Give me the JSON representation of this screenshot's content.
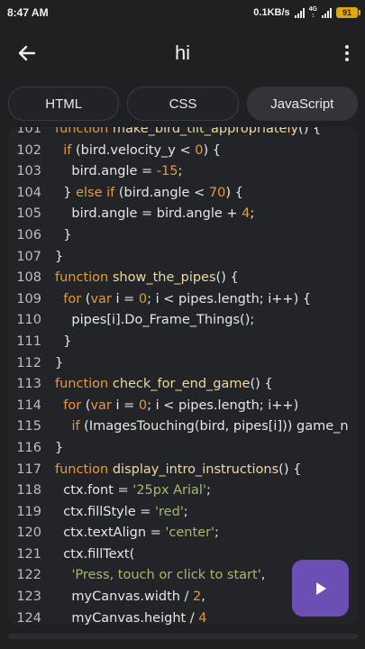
{
  "status": {
    "time": "8:47 AM",
    "netspeed": "0.1KB/s",
    "network": "4G",
    "battery": "91"
  },
  "appbar": {
    "title": "hi"
  },
  "tabs": [
    "HTML",
    "CSS",
    "JavaScript"
  ],
  "active_tab": "JavaScript",
  "code_lines": [
    {
      "n": "101",
      "tokens": [
        [
          "kw",
          "function "
        ],
        [
          "fn",
          "make_bird_tilt_appropriately"
        ],
        [
          "",
          "() {"
        ]
      ]
    },
    {
      "n": "102",
      "tokens": [
        [
          "",
          "  "
        ],
        [
          "kw",
          "if"
        ],
        [
          "",
          " (bird.velocity_y < "
        ],
        [
          "num",
          "0"
        ],
        [
          "",
          ") {"
        ]
      ]
    },
    {
      "n": "103",
      "tokens": [
        [
          "",
          "    bird.angle = "
        ],
        [
          "num",
          "-15"
        ],
        [
          "",
          ";"
        ]
      ]
    },
    {
      "n": "104",
      "tokens": [
        [
          "",
          "  } "
        ],
        [
          "kw",
          "else if"
        ],
        [
          "",
          " (bird.angle < "
        ],
        [
          "num",
          "70"
        ],
        [
          "",
          ") {"
        ]
      ]
    },
    {
      "n": "105",
      "tokens": [
        [
          "",
          "    bird.angle = bird.angle + "
        ],
        [
          "num",
          "4"
        ],
        [
          "",
          ";"
        ]
      ]
    },
    {
      "n": "106",
      "tokens": [
        [
          "",
          "  }"
        ]
      ]
    },
    {
      "n": "107",
      "tokens": [
        [
          "",
          "}"
        ]
      ]
    },
    {
      "n": "108",
      "tokens": [
        [
          "kw",
          "function "
        ],
        [
          "fn",
          "show_the_pipes"
        ],
        [
          "",
          "() {"
        ]
      ]
    },
    {
      "n": "109",
      "tokens": [
        [
          "",
          "  "
        ],
        [
          "kw",
          "for"
        ],
        [
          "",
          " ("
        ],
        [
          "kw",
          "var"
        ],
        [
          "",
          " i = "
        ],
        [
          "num",
          "0"
        ],
        [
          "",
          "; i < pipes.length; i++) {"
        ]
      ]
    },
    {
      "n": "110",
      "tokens": [
        [
          "",
          "    pipes[i].Do_Frame_Things();"
        ]
      ]
    },
    {
      "n": "111",
      "tokens": [
        [
          "",
          "  }"
        ]
      ]
    },
    {
      "n": "112",
      "tokens": [
        [
          "",
          "}"
        ]
      ]
    },
    {
      "n": "113",
      "tokens": [
        [
          "kw",
          "function "
        ],
        [
          "fn",
          "check_for_end_game"
        ],
        [
          "",
          "() {"
        ]
      ]
    },
    {
      "n": "114",
      "tokens": [
        [
          "",
          "  "
        ],
        [
          "kw",
          "for"
        ],
        [
          "",
          " ("
        ],
        [
          "kw",
          "var"
        ],
        [
          "",
          " i = "
        ],
        [
          "num",
          "0"
        ],
        [
          "",
          "; i < pipes.length; i++)"
        ]
      ]
    },
    {
      "n": "115",
      "tokens": [
        [
          "",
          "    "
        ],
        [
          "kw",
          "if"
        ],
        [
          "",
          " (ImagesTouching(bird, pipes[i])) game_n"
        ]
      ]
    },
    {
      "n": "116",
      "tokens": [
        [
          "",
          "}"
        ]
      ]
    },
    {
      "n": "117",
      "tokens": [
        [
          "kw",
          "function "
        ],
        [
          "fn",
          "display_intro_instructions"
        ],
        [
          "",
          "() {"
        ]
      ]
    },
    {
      "n": "118",
      "tokens": [
        [
          "",
          "  ctx.font = "
        ],
        [
          "str",
          "'25px Arial'"
        ],
        [
          "",
          ";"
        ]
      ]
    },
    {
      "n": "119",
      "tokens": [
        [
          "",
          "  ctx.fillStyle = "
        ],
        [
          "str",
          "'red'"
        ],
        [
          "",
          ";"
        ]
      ]
    },
    {
      "n": "120",
      "tokens": [
        [
          "",
          "  ctx.textAlign = "
        ],
        [
          "str",
          "'center'"
        ],
        [
          "",
          ";"
        ]
      ]
    },
    {
      "n": "121",
      "tokens": [
        [
          "",
          "  ctx.fillText("
        ]
      ]
    },
    {
      "n": "122",
      "tokens": [
        [
          "",
          "    "
        ],
        [
          "str",
          "'Press, touch or click to start'"
        ],
        [
          "",
          ","
        ]
      ]
    },
    {
      "n": "123",
      "tokens": [
        [
          "",
          "    myCanvas.width / "
        ],
        [
          "num",
          "2"
        ],
        [
          "",
          ","
        ]
      ]
    },
    {
      "n": "124",
      "tokens": [
        [
          "",
          "    myCanvas.height / "
        ],
        [
          "num",
          "4"
        ]
      ]
    }
  ],
  "colors": {
    "keyword": "#e59a3a",
    "function_name": "#ecd9a0",
    "string": "#a7b96b",
    "run_button": "#6b4fb4"
  },
  "icons": {
    "back": "arrow-left-icon",
    "more": "more-vertical-icon",
    "run": "play-icon"
  }
}
